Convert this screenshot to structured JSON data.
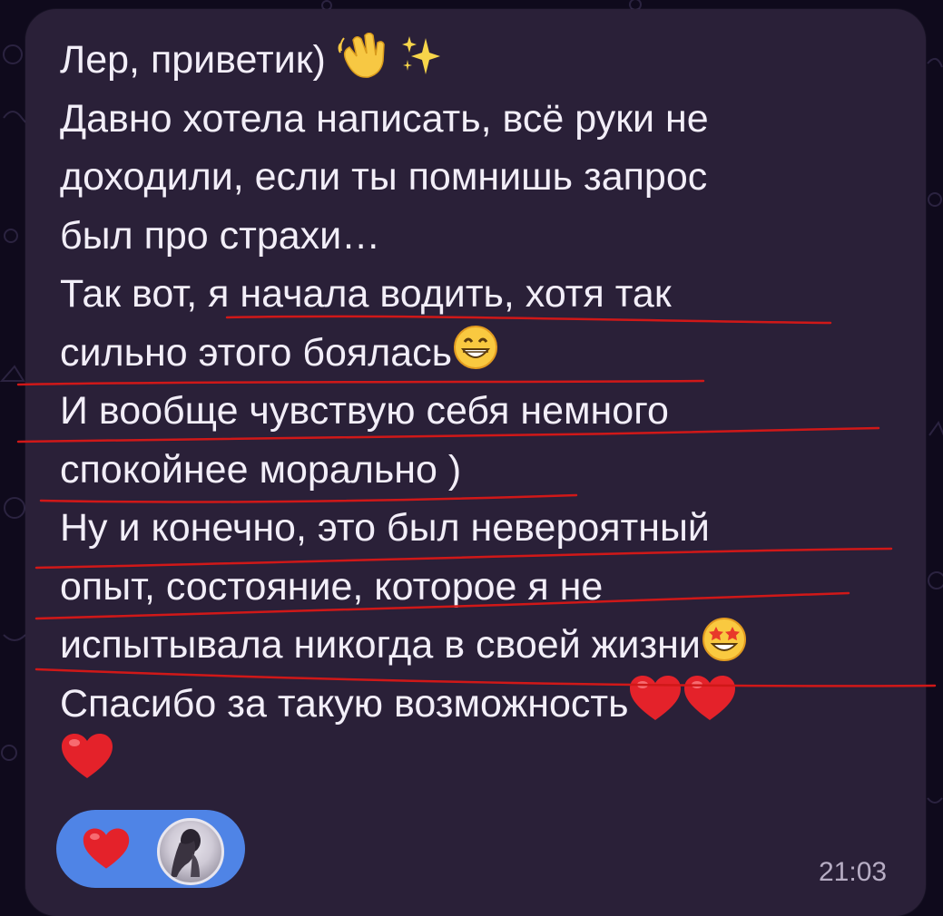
{
  "message": {
    "lines": [
      "Лер, приветик)",
      "Давно хотела написать, всё руки не",
      "доходили, если ты помнишь запрос",
      "был про страхи…",
      "Так вот, я начала водить, хотя так",
      "сильно этого боялась",
      "И вообще чувствую себя немного",
      "спокойнее морально )",
      "Ну и конечно, это был невероятный",
      "опыт, состояние, которое я не",
      "испытывала никогда в своей жизни",
      "Спасибо за такую возможность"
    ],
    "emojis": {
      "wave": "👋",
      "sparkles": "✨",
      "grin": "😁",
      "star_struck": "🤩",
      "heart": "❤️"
    },
    "time": "21:03"
  },
  "reaction": {
    "icon": "red-heart-icon",
    "avatar": "user-avatar"
  },
  "colors": {
    "background": "#0f0a1c",
    "bubble": "#2a2038",
    "text": "#f2eef8",
    "underline": "#d01818",
    "reaction_pill": "#4f84e6",
    "timestamp": "#b7adc4"
  }
}
